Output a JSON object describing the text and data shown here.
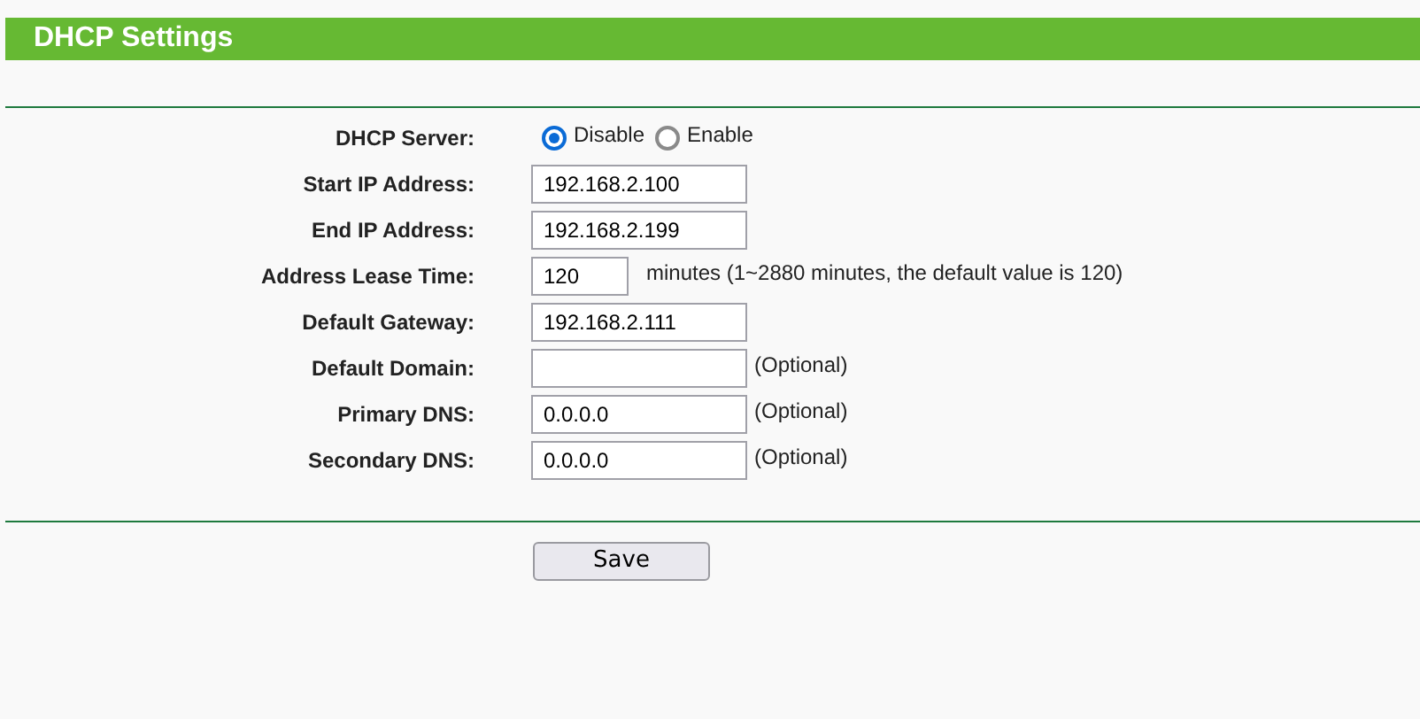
{
  "header": {
    "title": "DHCP Settings"
  },
  "rows": [
    {
      "kind": "radio",
      "label": "DHCP Server:",
      "options": [
        {
          "label": "Disable",
          "selected": true
        },
        {
          "label": "Enable",
          "selected": false
        }
      ]
    },
    {
      "kind": "input",
      "label": "Start IP Address:",
      "value": "192.168.2.100"
    },
    {
      "kind": "input",
      "label": "End IP Address:",
      "value": "192.168.2.199"
    },
    {
      "kind": "short_input",
      "label": "Address Lease Time:",
      "value": "120",
      "note": "minutes (1~2880 minutes, the default value is 120)"
    },
    {
      "kind": "input",
      "label": "Default Gateway:",
      "value": "192.168.2.111"
    },
    {
      "kind": "input",
      "label": "Default Domain:",
      "note": "(Optional)"
    },
    {
      "kind": "input",
      "label": "Primary DNS:",
      "value": "0.0.0.0",
      "note": "(Optional)"
    },
    {
      "kind": "input",
      "label": "Secondary DNS:",
      "value": "0.0.0.0",
      "note": "(Optional)"
    }
  ],
  "buttons": [
    {
      "label": "Save"
    }
  ]
}
